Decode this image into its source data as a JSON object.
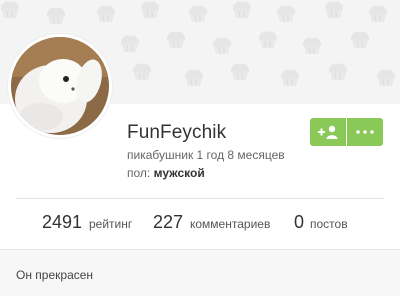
{
  "profile": {
    "username": "FunFeychik",
    "since": "пикабушник 1 год 8 месяцев",
    "gender_label": "пол:",
    "gender_value": "мужской",
    "about": "Он прекрасен"
  },
  "stats": [
    {
      "value": "2491",
      "label": "рейтинг"
    },
    {
      "value": "227",
      "label": "комментариев"
    },
    {
      "value": "0",
      "label": "постов"
    }
  ],
  "actions": {
    "subscribe_icon": "add-user-icon",
    "more_icon": "more-dots-icon"
  },
  "colors": {
    "accent": "#8ac858",
    "banner": "#f4f4f4"
  }
}
